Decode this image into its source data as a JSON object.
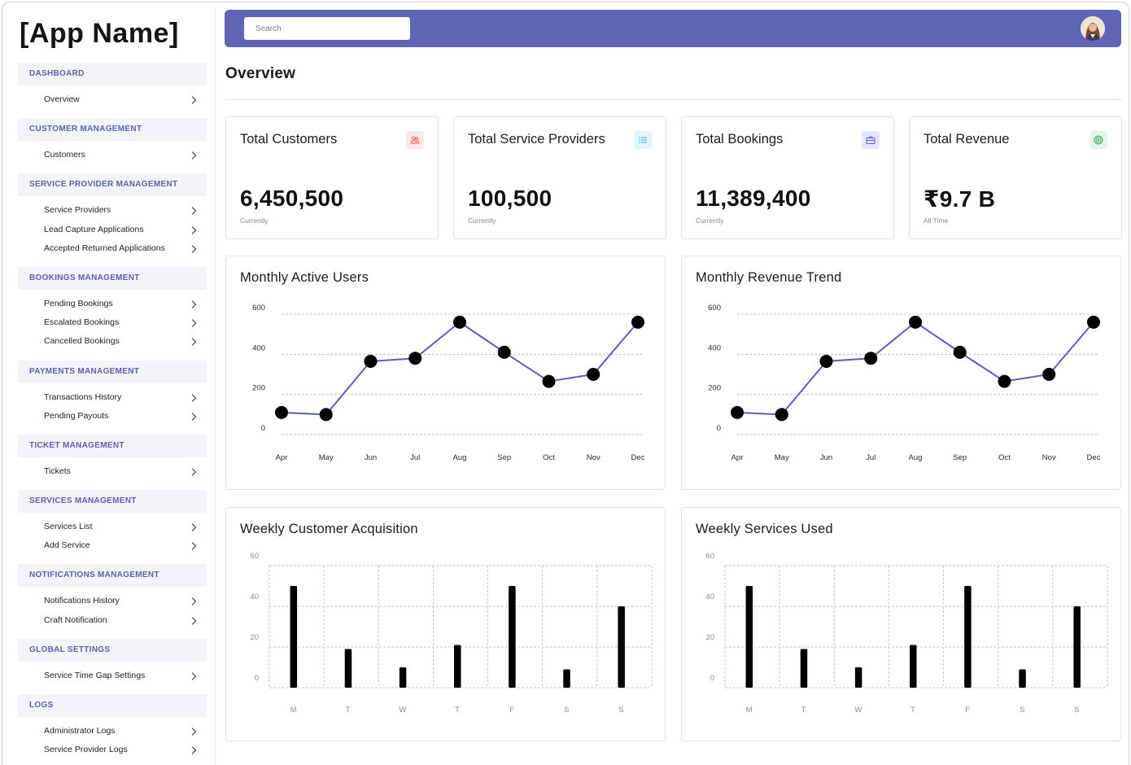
{
  "app": {
    "name": "[App Name]"
  },
  "search": {
    "placeholder": "Search",
    "value": ""
  },
  "header": {
    "avatar_icon": "user-avatar"
  },
  "page": {
    "title": "Overview"
  },
  "sidebar": {
    "sections": [
      {
        "title": "DASHBOARD",
        "items": [
          "Overview"
        ]
      },
      {
        "title": "CUSTOMER MANAGEMENT",
        "items": [
          "Customers"
        ]
      },
      {
        "title": "SERVICE PROVIDER MANAGEMENT",
        "items": [
          "Service Providers",
          "Lead Capture Applications",
          "Accepted Returned Applications"
        ]
      },
      {
        "title": "BOOKINGS MANAGEMENT",
        "items": [
          "Pending Bookings",
          "Escalated Bookings",
          "Cancelled Bookings"
        ]
      },
      {
        "title": "PAYMENTS MANAGEMENT",
        "items": [
          "Transactions History",
          "Pending Payouts"
        ]
      },
      {
        "title": "TICKET MANAGEMENT",
        "items": [
          "Tickets"
        ]
      },
      {
        "title": "SERVICES MANAGEMENT",
        "items": [
          "Services List",
          "Add Service"
        ]
      },
      {
        "title": "NOTIFICATIONS MANAGEMENT",
        "items": [
          "Notifications History",
          "Craft Notification"
        ]
      },
      {
        "title": "GLOBAL SETTINGS",
        "items": [
          "Service Time Gap Settings"
        ]
      },
      {
        "title": "LOGS",
        "items": [
          "Administrator Logs",
          "Service Provider Logs"
        ]
      }
    ]
  },
  "stats": [
    {
      "title": "Total Customers",
      "value": "6,450,500",
      "sub": "Currently",
      "icon": "users-icon",
      "icon_bg": "#fde7e7",
      "icon_color": "#e05a5a"
    },
    {
      "title": "Total Service Providers",
      "value": "100,500",
      "sub": "Currently",
      "icon": "list-icon",
      "icon_bg": "#e3f4fc",
      "icon_color": "#3aa7dd"
    },
    {
      "title": "Total Bookings",
      "value": "11,389,400",
      "sub": "Currently",
      "icon": "briefcase-icon",
      "icon_bg": "#e4e4fb",
      "icon_color": "#5b5fc4"
    },
    {
      "title": "Total Revenue",
      "value": "₹9.7 B",
      "sub": "All Time",
      "icon": "target-icon",
      "icon_bg": "#e2f5e8",
      "icon_color": "#3aa66a"
    }
  ],
  "colors": {
    "accent": "#6064b4",
    "line": "#5c5fb3",
    "bar": "#000000"
  },
  "chart_data": [
    {
      "type": "line",
      "title": "Monthly Active Users",
      "categories": [
        "Apr",
        "May",
        "Jun",
        "Jul",
        "Aug",
        "Sep",
        "Oct",
        "Nov",
        "Dec"
      ],
      "values": [
        110,
        100,
        365,
        380,
        560,
        410,
        265,
        300,
        560
      ],
      "ylim": [
        0,
        600
      ],
      "yticks": [
        0,
        200,
        400,
        600
      ],
      "grid": true
    },
    {
      "type": "line",
      "title": "Monthly Revenue Trend",
      "categories": [
        "Apr",
        "May",
        "Jun",
        "Jul",
        "Aug",
        "Sep",
        "Oct",
        "Nov",
        "Dec"
      ],
      "values": [
        110,
        100,
        365,
        380,
        560,
        410,
        265,
        300,
        560
      ],
      "ylim": [
        0,
        600
      ],
      "yticks": [
        0,
        200,
        400,
        600
      ],
      "grid": true
    },
    {
      "type": "bar",
      "title": "Weekly Customer Acquisition",
      "categories": [
        "M",
        "T",
        "W",
        "T",
        "F",
        "S",
        "S"
      ],
      "values": [
        50,
        19,
        10,
        21,
        50,
        9,
        40
      ],
      "ylim": [
        0,
        60
      ],
      "yticks": [
        0,
        20,
        40,
        60
      ],
      "grid": true
    },
    {
      "type": "bar",
      "title": "Weekly Services Used",
      "categories": [
        "M",
        "T",
        "W",
        "T",
        "F",
        "S",
        "S"
      ],
      "values": [
        50,
        19,
        10,
        21,
        50,
        9,
        40
      ],
      "ylim": [
        0,
        60
      ],
      "yticks": [
        0,
        20,
        40,
        60
      ],
      "grid": true
    }
  ]
}
